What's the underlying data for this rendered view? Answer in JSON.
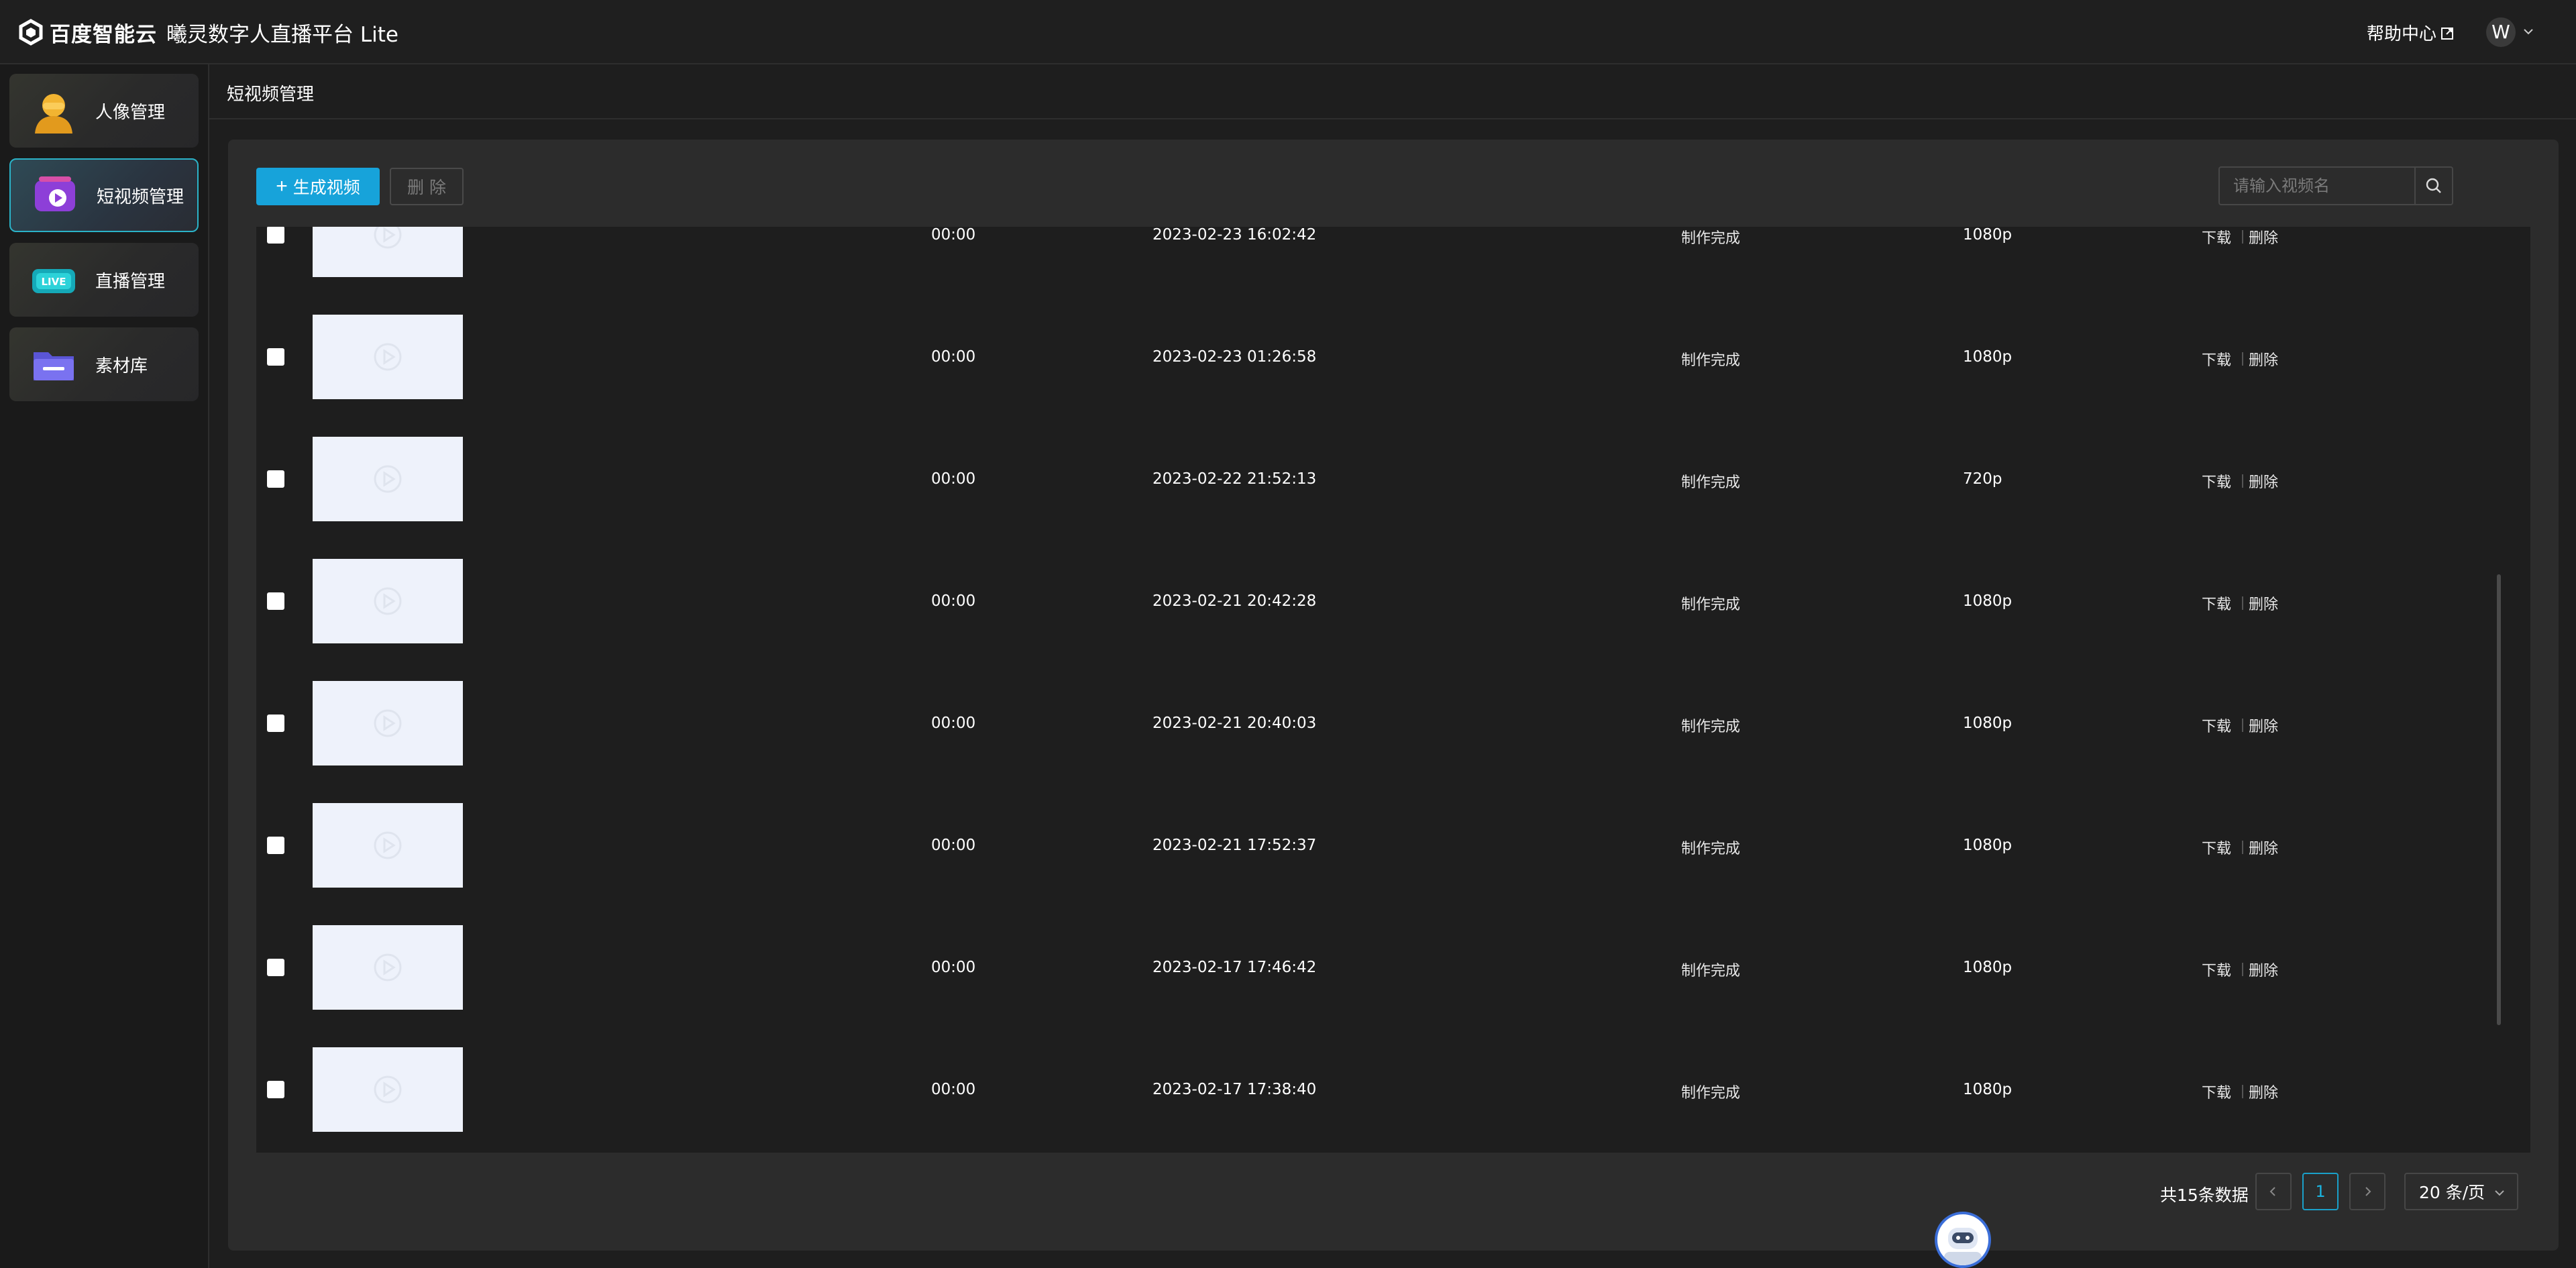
{
  "header": {
    "brand": "百度智能云",
    "product": "曦灵数字人直播平台 Lite",
    "help_label": "帮助中心",
    "user_initial": "W"
  },
  "sidebar": {
    "items": [
      {
        "label": "人像管理",
        "icon": "avatar-icon",
        "active": false
      },
      {
        "label": "短视频管理",
        "icon": "video-icon",
        "active": true
      },
      {
        "label": "直播管理",
        "icon": "live-icon",
        "active": false
      },
      {
        "label": "素材库",
        "icon": "folder-icon",
        "active": false
      }
    ]
  },
  "breadcrumb": {
    "title": "短视频管理"
  },
  "toolbar": {
    "generate_label": "生成视频",
    "delete_label": "删 除",
    "search_placeholder": "请输入视频名"
  },
  "table": {
    "rows": [
      {
        "duration": "00:00",
        "created": "2023-02-23 16:02:42",
        "status": "制作完成",
        "resolution": "1080p",
        "download": "下载",
        "delete": "删除"
      },
      {
        "duration": "00:00",
        "created": "2023-02-23 01:26:58",
        "status": "制作完成",
        "resolution": "1080p",
        "download": "下载",
        "delete": "删除"
      },
      {
        "duration": "00:00",
        "created": "2023-02-22 21:52:13",
        "status": "制作完成",
        "resolution": "720p",
        "download": "下载",
        "delete": "删除"
      },
      {
        "duration": "00:00",
        "created": "2023-02-21 20:42:28",
        "status": "制作完成",
        "resolution": "1080p",
        "download": "下载",
        "delete": "删除"
      },
      {
        "duration": "00:00",
        "created": "2023-02-21 20:40:03",
        "status": "制作完成",
        "resolution": "1080p",
        "download": "下载",
        "delete": "删除"
      },
      {
        "duration": "00:00",
        "created": "2023-02-21 17:52:37",
        "status": "制作完成",
        "resolution": "1080p",
        "download": "下载",
        "delete": "删除"
      },
      {
        "duration": "00:00",
        "created": "2023-02-17 17:46:42",
        "status": "制作完成",
        "resolution": "1080p",
        "download": "下载",
        "delete": "删除"
      },
      {
        "duration": "00:00",
        "created": "2023-02-17 17:38:40",
        "status": "制作完成",
        "resolution": "1080p",
        "download": "下载",
        "delete": "删除"
      }
    ]
  },
  "pagination": {
    "total_label": "共15条数据",
    "current_page": "1",
    "page_size_label": "20 条/页"
  },
  "colors": {
    "accent": "#17a3da",
    "background": "#1e1e1e",
    "panel": "#2c2c2c"
  }
}
